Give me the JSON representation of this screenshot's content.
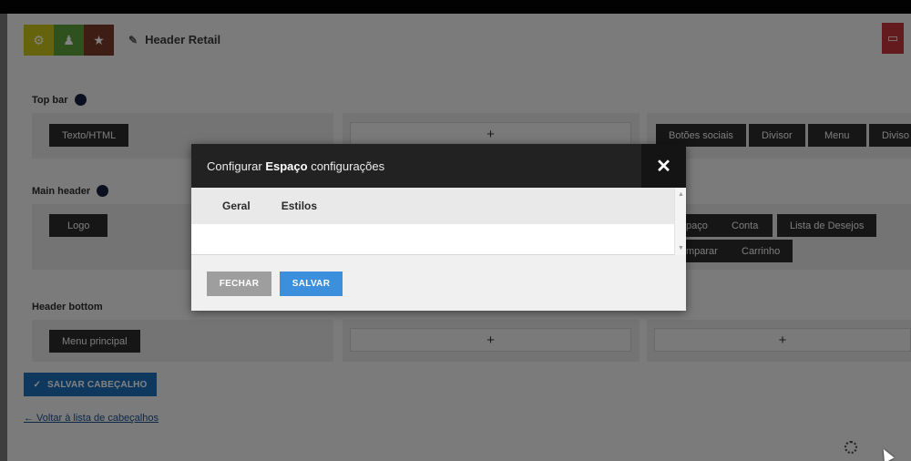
{
  "header_builder": {
    "title": "Header Retail",
    "icons": {
      "settings": "gear-icon",
      "badge": "badge-icon",
      "favorite": "star-icon",
      "edit": "pencil-icon"
    }
  },
  "sections": {
    "top_bar": {
      "label": "Top bar",
      "left_items": [
        "Texto/HTML"
      ],
      "center_add": "+",
      "right_items": [
        "Botões sociais",
        "Divisor",
        "Menu",
        "Diviso"
      ]
    },
    "main_header": {
      "label": "Main header",
      "left_items": [
        "Logo"
      ],
      "right_items_row1": [
        "paço",
        "Conta",
        "Lista de Desejos"
      ],
      "right_items_row2": [
        "mparar",
        "Carrinho"
      ]
    },
    "header_bottom": {
      "label": "Header bottom",
      "left_items": [
        "Menu principal"
      ],
      "center_add": "+",
      "right_add": "+"
    }
  },
  "actions": {
    "save_header": "SALVAR CABEÇALHO",
    "save_header_icon": "✓",
    "back_link": "← Voltar à lista de cabeçalhos"
  },
  "modal": {
    "title_prefix": "Configurar",
    "title_bold": "Espaço",
    "title_suffix": "configurações",
    "close": "✕",
    "tabs": [
      "Geral",
      "Estilos"
    ],
    "buttons": {
      "close": "FECHAR",
      "save": "SALVAR"
    }
  },
  "colors": {
    "save_header_bg": "#1f6fb8",
    "modal_save_bg": "#3b8fdc",
    "modal_close_bg": "#9e9e9e",
    "modal_header_bg": "#222222"
  }
}
